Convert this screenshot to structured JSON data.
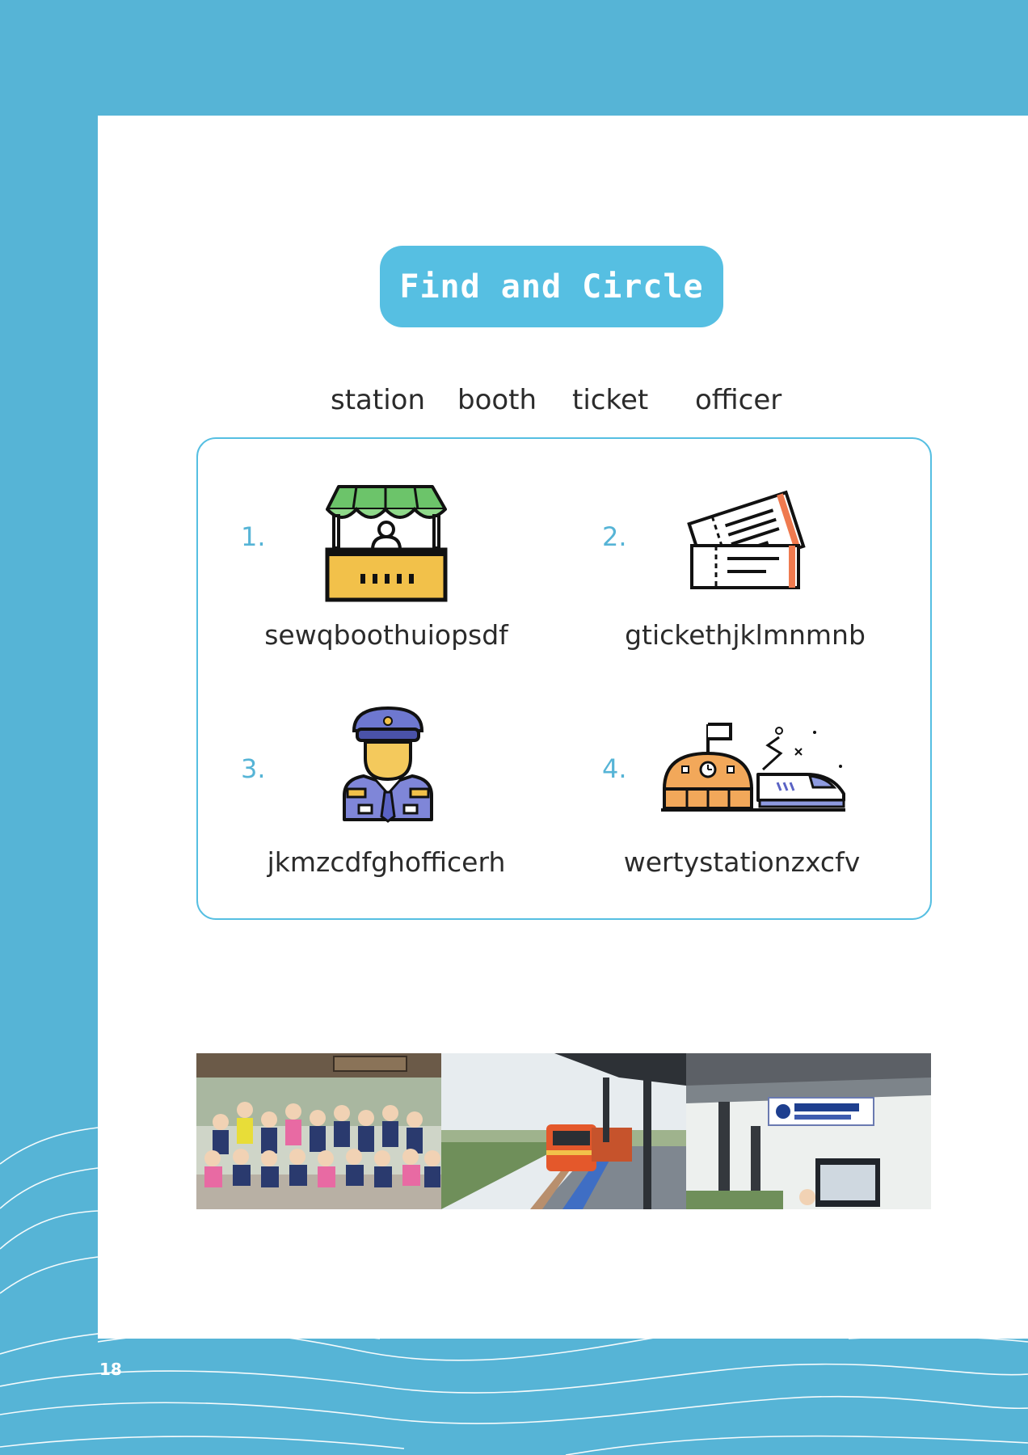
{
  "title": "Find and Circle",
  "word_bank": [
    "station",
    "booth",
    "ticket",
    "officer"
  ],
  "puzzles": [
    {
      "number": "1.",
      "text": "sewqboothuiopsdf",
      "icon": "ticket-booth-icon"
    },
    {
      "number": "2.",
      "text": "gtickethjklmnmnb",
      "icon": "ticket-icon"
    },
    {
      "number": "3.",
      "text": "jkmzcdfghofficerh",
      "icon": "officer-icon"
    },
    {
      "number": "4.",
      "text": "wertystationzxcfv",
      "icon": "station-train-icon"
    }
  ],
  "photos": [
    {
      "name": "children-group-photo"
    },
    {
      "name": "train-platform-photo"
    },
    {
      "name": "station-sign-photo"
    }
  ],
  "page_number": "18",
  "colors": {
    "background": "#56b4d6",
    "accent": "#56bfe2",
    "number_color": "#56b4d6",
    "text": "#2b2b2b"
  }
}
